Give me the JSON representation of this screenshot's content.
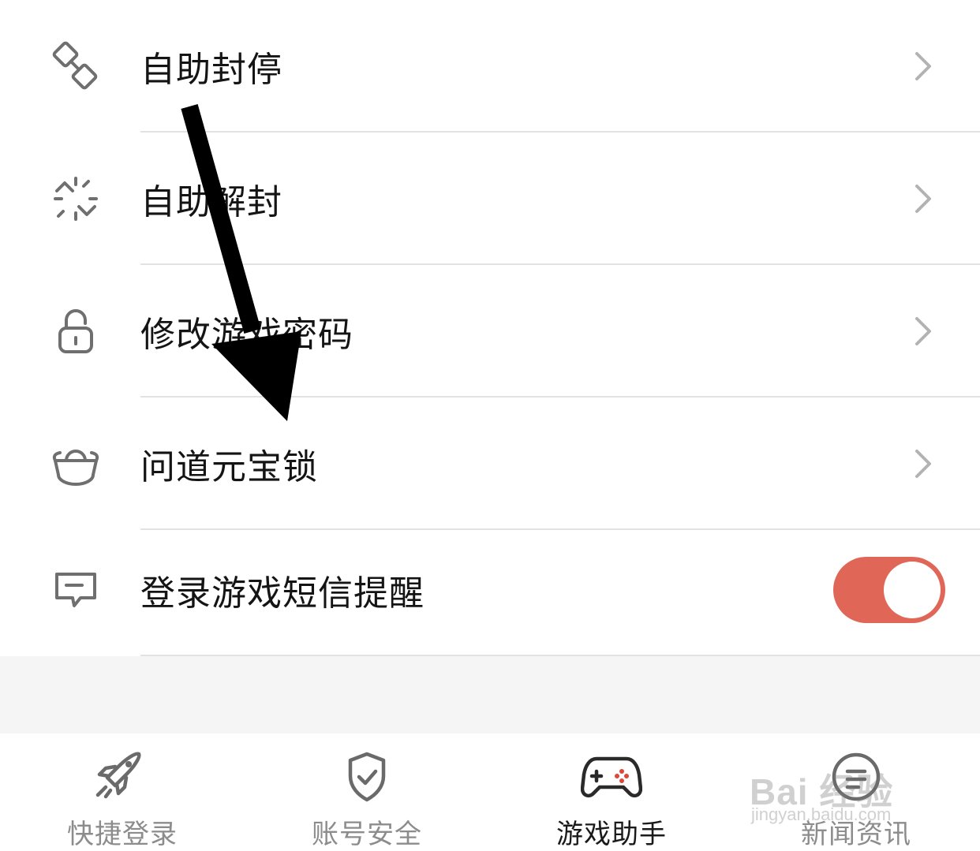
{
  "menu": {
    "items": [
      {
        "label": "自助封停",
        "icon": "link-icon",
        "control": "chevron"
      },
      {
        "label": "自助解封",
        "icon": "broken-link-icon",
        "control": "chevron"
      },
      {
        "label": "修改游戏密码",
        "icon": "lock-icon",
        "control": "chevron"
      },
      {
        "label": "问道元宝锁",
        "icon": "ingot-icon",
        "control": "chevron"
      },
      {
        "label": "登录游戏短信提醒",
        "icon": "message-icon",
        "control": "toggle",
        "toggle_on": true
      }
    ]
  },
  "tabbar": {
    "tabs": [
      {
        "label": "快捷登录",
        "icon": "rocket-icon",
        "active": false
      },
      {
        "label": "账号安全",
        "icon": "shield-check-icon",
        "active": false
      },
      {
        "label": "游戏助手",
        "icon": "gamepad-icon",
        "active": true
      },
      {
        "label": "新闻资讯",
        "icon": "news-icon",
        "active": false
      }
    ]
  },
  "watermark": {
    "main": "Bai 经验",
    "sub": "jingyan.baidu.com"
  },
  "colors": {
    "toggle_on": "#e06758",
    "label_text": "#141414",
    "tab_inactive": "#8c8c8c",
    "divider": "#e2e2e2",
    "gamepad_accent": "#e0453a"
  }
}
